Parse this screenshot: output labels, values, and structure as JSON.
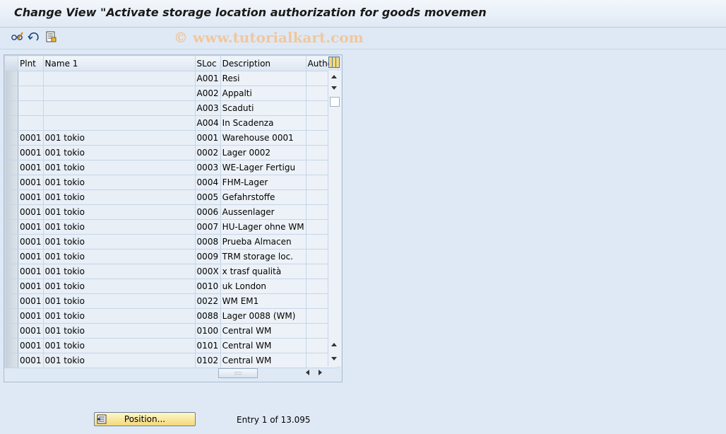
{
  "header": {
    "title": "Change View \"Activate storage location authorization for goods movemen",
    "watermark": "© www.tutorialkart.com"
  },
  "toolbar": {
    "icons": [
      "edit-glasses-icon",
      "undo-icon",
      "details-icon"
    ]
  },
  "grid": {
    "columns": [
      "Plnt",
      "Name 1",
      "SLoc",
      "Description",
      "Author"
    ],
    "rows": [
      {
        "plnt": "",
        "name": "",
        "sloc": "A001",
        "desc": "Resi",
        "author": false
      },
      {
        "plnt": "",
        "name": "",
        "sloc": "A002",
        "desc": "Appalti",
        "author": false
      },
      {
        "plnt": "",
        "name": "",
        "sloc": "A003",
        "desc": "Scaduti",
        "author": false
      },
      {
        "plnt": "",
        "name": "",
        "sloc": "A004",
        "desc": "In Scadenza",
        "author": false
      },
      {
        "plnt": "0001",
        "name": "001 tokio",
        "sloc": "0001",
        "desc": "Warehouse 0001",
        "author": false
      },
      {
        "plnt": "0001",
        "name": "001 tokio",
        "sloc": "0002",
        "desc": "Lager 0002",
        "author": false
      },
      {
        "plnt": "0001",
        "name": "001 tokio",
        "sloc": "0003",
        "desc": "WE-Lager Fertigu",
        "author": false
      },
      {
        "plnt": "0001",
        "name": "001 tokio",
        "sloc": "0004",
        "desc": "FHM-Lager",
        "author": false
      },
      {
        "plnt": "0001",
        "name": "001 tokio",
        "sloc": "0005",
        "desc": "Gefahrstoffe",
        "author": false
      },
      {
        "plnt": "0001",
        "name": "001 tokio",
        "sloc": "0006",
        "desc": "Aussenlager",
        "author": false
      },
      {
        "plnt": "0001",
        "name": "001 tokio",
        "sloc": "0007",
        "desc": "HU-Lager ohne WM",
        "author": false
      },
      {
        "plnt": "0001",
        "name": "001 tokio",
        "sloc": "0008",
        "desc": "Prueba Almacen",
        "author": false
      },
      {
        "plnt": "0001",
        "name": "001 tokio",
        "sloc": "0009",
        "desc": "TRM storage loc.",
        "author": false
      },
      {
        "plnt": "0001",
        "name": "001 tokio",
        "sloc": "000X",
        "desc": "x trasf qualità",
        "author": false
      },
      {
        "plnt": "0001",
        "name": "001 tokio",
        "sloc": "0010",
        "desc": "uk London",
        "author": false
      },
      {
        "plnt": "0001",
        "name": "001 tokio",
        "sloc": "0022",
        "desc": "WM EM1",
        "author": false
      },
      {
        "plnt": "0001",
        "name": "001 tokio",
        "sloc": "0088",
        "desc": "Lager 0088 (WM)",
        "author": false
      },
      {
        "plnt": "0001",
        "name": "001 tokio",
        "sloc": "0100",
        "desc": "Central WM",
        "author": false
      },
      {
        "plnt": "0001",
        "name": "001 tokio",
        "sloc": "0101",
        "desc": "Central WM",
        "author": false
      },
      {
        "plnt": "0001",
        "name": "001 tokio",
        "sloc": "0102",
        "desc": "Central WM",
        "author": false
      }
    ]
  },
  "footer": {
    "position_label": "Position...",
    "entry_text": "Entry 1 of 13.095"
  },
  "colors": {
    "background": "#dfe9f5",
    "button_yellow": "#f3d97a",
    "watermark": "#f1c79c"
  }
}
